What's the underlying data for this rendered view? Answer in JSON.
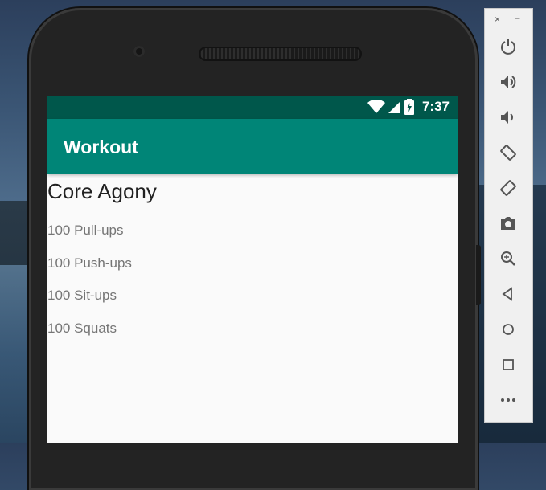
{
  "status_bar": {
    "time": "7:37"
  },
  "app_bar": {
    "title": "Workout"
  },
  "workout": {
    "name": "Core Agony",
    "description_lines": [
      "100 Pull-ups",
      "100 Push-ups",
      "100 Sit-ups",
      "100 Squats"
    ]
  },
  "emulator_panel": {
    "close_label": "×",
    "minimize_label": "−",
    "buttons": [
      "power-icon",
      "volume-up-icon",
      "volume-down-icon",
      "rotate-left-icon",
      "rotate-right-icon",
      "camera-icon",
      "zoom-icon",
      "back-icon",
      "home-icon",
      "overview-icon",
      "more-icon"
    ]
  },
  "colors": {
    "status_bar": "#00574b",
    "app_bar": "#008577",
    "screen_bg": "#fafafa"
  }
}
